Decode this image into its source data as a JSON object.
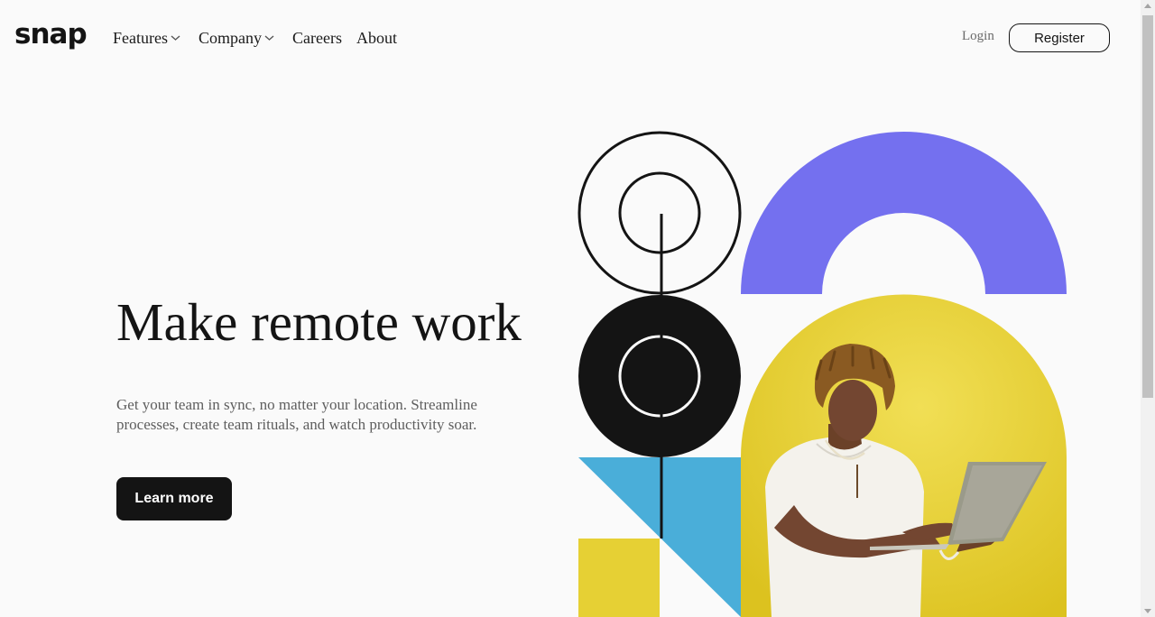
{
  "header": {
    "logo": "snap",
    "nav": [
      {
        "label": "Features",
        "has_dropdown": true,
        "icon": "chevron-down-icon"
      },
      {
        "label": "Company",
        "has_dropdown": true,
        "icon": "chevron-down-icon"
      },
      {
        "label": "Careers",
        "has_dropdown": false
      },
      {
        "label": "About",
        "has_dropdown": false
      }
    ],
    "login_label": "Login",
    "register_label": "Register"
  },
  "hero": {
    "title": "Make remote work",
    "description": "Get your team in sync, no matter your location. Streamline processes, create team rituals, and watch productivity soar.",
    "cta_label": "Learn more"
  },
  "illustration": {
    "person_photo": "man-with-laptop-photo",
    "colors": {
      "purple": "#7470ef",
      "yellow": "#e6d034",
      "blue": "#4aaed9",
      "dark": "#141414",
      "background": "#fafafa"
    }
  }
}
